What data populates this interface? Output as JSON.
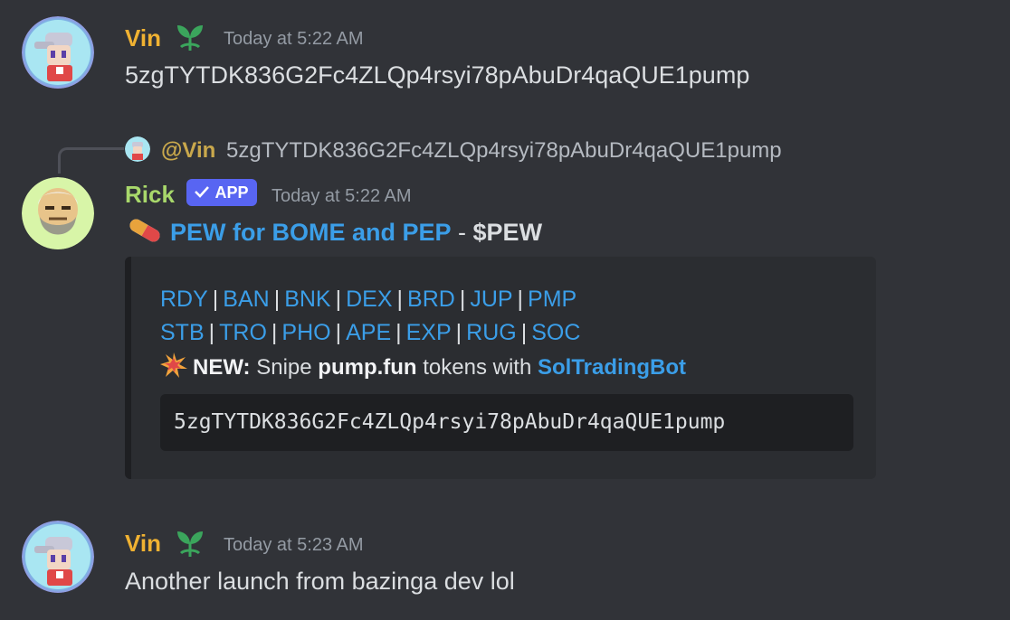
{
  "messages": [
    {
      "username": "Vin",
      "username_color": "#f0b232",
      "badge_icon": "sprout-icon",
      "timestamp": "Today at 5:22 AM",
      "content": "5zgTYTDK836G2Fc4ZLQp4rsyi78pAbuDr4qaQUE1pump"
    },
    {
      "reply": {
        "mention": "@Vin",
        "preview": "5zgTYTDK836G2Fc4ZLQp4rsyi78pAbuDr4qaQUE1pump"
      },
      "username": "Rick",
      "username_color": "#a8d86b",
      "app_badge": "APP",
      "timestamp": "Today at 5:22 AM",
      "title_emoji": "pill-icon",
      "title_link": "PEW for BOME and PEP",
      "title_sep": " - ",
      "title_ticker": "$PEW",
      "embed": {
        "row1": [
          "RDY",
          "BAN",
          "BNK",
          "DEX",
          "BRD",
          "JUP",
          "PMP"
        ],
        "row2": [
          "STB",
          "TRO",
          "PHO",
          "APE",
          "EXP",
          "RUG",
          "SOC"
        ],
        "separator": "|",
        "new_emoji": "collision-icon",
        "new_label": "NEW:",
        "new_text_1": " Snipe ",
        "new_bold": "pump.fun",
        "new_text_2": " tokens with ",
        "new_link": "SolTradingBot",
        "code": "5zgTYTDK836G2Fc4ZLQp4rsyi78pAbuDr4qaQUE1pump"
      }
    },
    {
      "username": "Vin",
      "username_color": "#f0b232",
      "badge_icon": "sprout-icon",
      "timestamp": "Today at 5:23 AM",
      "content": "Another launch from bazinga dev lol"
    }
  ],
  "colors": {
    "background": "#313338",
    "link": "#3b9ee8",
    "app_badge": "#5865f2",
    "embed_bg": "#2b2d31"
  }
}
